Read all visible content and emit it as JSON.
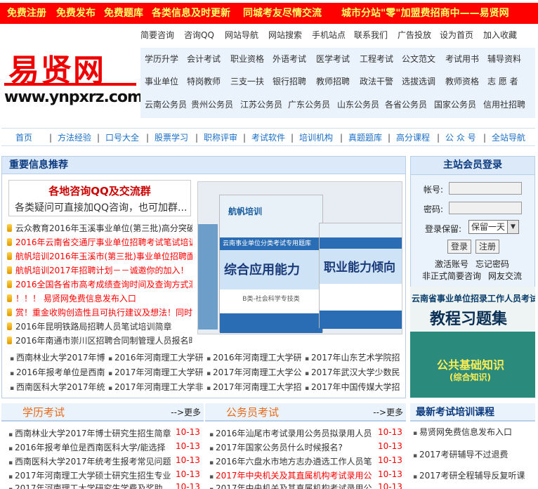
{
  "topbar": {
    "items": [
      "免费注册",
      "免费发布",
      "免费题库",
      "各类信息及时更新",
      "同城考友尽情交流",
      "城市分站\"零\"加盟费招商中——易贤网"
    ]
  },
  "toplinks": [
    "简要咨询",
    "咨询QQ",
    "网站导航",
    "网站搜索",
    "手机站点",
    "联系我们",
    "广告投放",
    "设为首页",
    "加入收藏"
  ],
  "logo": {
    "cn": "易贤网",
    "url": "www.ynpxrz.com"
  },
  "categories": [
    [
      "学历升学",
      "会计考试",
      "职业资格",
      "外语考试",
      "医学考试",
      "工程考试",
      "公文范文",
      "考试用书",
      "辅导资料"
    ],
    [
      "事业单位",
      "特岗教师",
      "三支一扶",
      "银行招聘",
      "教师招聘",
      "政法干警",
      "选拔选调",
      "教师资格",
      "志 愿 者"
    ],
    [
      "云南公务员",
      "贵州公务员",
      "江苏公务员",
      "广东公务员",
      "山东公务员",
      "各省公务员",
      "国家公务员",
      "信用社招聘"
    ]
  ],
  "navbar": [
    "首页",
    "方法经验",
    "口号大全",
    "股票学习",
    "职称评审",
    "考试软件",
    "培训机构",
    "真题题库",
    "高分课程",
    "公 众 号",
    "全站导航"
  ],
  "important": {
    "title": "重要信息推荐",
    "qq_title": "各地咨询QQ及交流群",
    "qq_sub": "各类疑问可直接加QQ咨询，也可加群...",
    "news": [
      {
        "text": "云众教育2016年玉溪事业单位(第三批)高分突破",
        "color": "#333333"
      },
      {
        "text": "2016年云南省交通厅事业单位招聘考试笔试培训",
        "color": "#ff0000"
      },
      {
        "text": "航帆培训2016年玉溪市(第三批)事业单位招聘面",
        "color": "#ff0000"
      },
      {
        "text": "航帆培训2017年招聘计划－－诚邀你的加入！",
        "color": "#ff0000"
      },
      {
        "text": "2016全国各省市高考成绩查询时间及查询方式汇",
        "color": "#ff0000"
      },
      {
        "text": "！！！ 易贤网免费信息发布入口",
        "color": "#ff0000"
      },
      {
        "text": "赏！重金收购创造性且可执行建议及想法！同时",
        "color": "#ff0000"
      },
      {
        "text": "2016年昆明铁路局招聘人员笔试培训简章",
        "color": "#333333"
      },
      {
        "text": "2016年南通市崇川区招聘合同制管理人员报名时",
        "color": "#333333"
      }
    ],
    "book_left": "综合应用能力",
    "book_right": "职业能力倾向",
    "book_brand": "航帆培训",
    "book_sub1": "云南事业单位分类考试专用题库",
    "book_sub2": "B类-社会科学专技类",
    "links": [
      [
        "西南林业大学2017年博",
        "2016年河南理工大学研",
        "2016年河南理工大学研",
        "2017年山东艺术学院招"
      ],
      [
        "2016年报考单位是西南",
        "2017年河南理工大学研",
        "2017年河南理工大学公",
        "2017年武汉大学少数民"
      ],
      [
        "西南医科大学2017年统",
        "2017年河南理工大学非",
        "2017年河南理工大学招",
        "2017年中国传媒大学招"
      ]
    ]
  },
  "login": {
    "title": "主站会员登录",
    "account_label": "帐号:",
    "password_label": "密码:",
    "remember_label": "登录保留:",
    "remember_value": "保留一天",
    "login_btn": "登录",
    "register_btn": "注册",
    "activate": "激活账号",
    "forgot": "忘记密码",
    "non_member": "非正式简要咨询",
    "chat": "网友交流"
  },
  "ad": {
    "line1": "云南省事业单位招录工作人员考试",
    "line2": "教程习题集",
    "line3": "公共基础知识",
    "line4": "(综合知识)"
  },
  "columns": {
    "xueli": {
      "title": "学历考试",
      "more": "-->更多",
      "rows": [
        {
          "text": "西南林业大学2017年博士研究生招生简章",
          "date": "10-13"
        },
        {
          "text": "2016年报考单位是西南医科大学/能选择",
          "date": "10-13"
        },
        {
          "text": "西南医科大学2017年统考生报考常见问题",
          "date": "10-13"
        },
        {
          "text": "2017年河南理工大学硕士研究生招生专业",
          "date": "10-13"
        },
        {
          "text": "2017年河南理工大学研究生学费及奖助",
          "date": "10-13"
        }
      ]
    },
    "gongwuyuan": {
      "title": "公务员考试",
      "more": "-->更多",
      "rows": [
        {
          "text": "2016年汕尾市考试录用公务员拟录用人员",
          "date": "10-13"
        },
        {
          "text": "2017年国家公务员什么时候报名?",
          "date": "10-13"
        },
        {
          "text": "2016年六盘水市地方志办遴选工作人员笔",
          "date": "10-13"
        },
        {
          "text": "2017年中央机关及其直属机构考试录用公",
          "date": "10-13"
        },
        {
          "text": "2017年中央机关及其直属机构考试录用公",
          "date": "10-13"
        }
      ]
    },
    "training": {
      "title": "最新考试培训课程",
      "rows": [
        "易贤网免费信息发布入口",
        "2017考研辅导不过退费",
        "2017考研全程辅导反复听课"
      ]
    }
  }
}
